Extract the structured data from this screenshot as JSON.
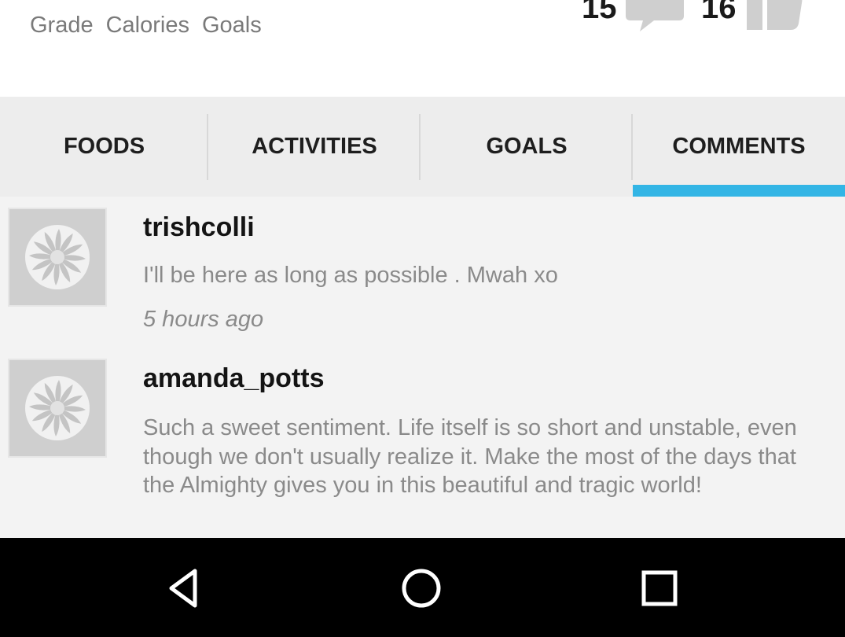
{
  "stats": {
    "labels": [
      "Grade",
      "Calories",
      "Goals"
    ],
    "comment_count": "15",
    "like_count": "16",
    "comment_icon": "speech-bubble-icon",
    "like_icon": "thumbs-up-icon"
  },
  "tabs": [
    {
      "label": "FOODS",
      "active": false
    },
    {
      "label": "ACTIVITIES",
      "active": false
    },
    {
      "label": "GOALS",
      "active": false
    },
    {
      "label": "COMMENTS",
      "active": true
    }
  ],
  "colors": {
    "accent": "#33b5e5",
    "tab_bg": "#ededed",
    "list_bg": "#f3f3f3",
    "avatar_bg": "#cfcfcf",
    "muted_text": "#8a8a8a"
  },
  "comments": [
    {
      "username": "trishcolli",
      "text": "I'll be here as long as possible . Mwah xo",
      "time": "5 hours ago",
      "avatar_icon": "default-avatar-pinwheel-icon"
    },
    {
      "username": "amanda_potts",
      "text": "Such a sweet sentiment.  Life itself is so short and unstable, even though we don't usually realize it.  Make the most of the days that the Almighty gives you in this beautiful and tragic world!",
      "avatar_icon": "default-avatar-pinwheel-icon"
    }
  ],
  "navbar": {
    "back_icon": "back-triangle-icon",
    "home_icon": "home-circle-icon",
    "recents_icon": "recents-square-icon"
  }
}
